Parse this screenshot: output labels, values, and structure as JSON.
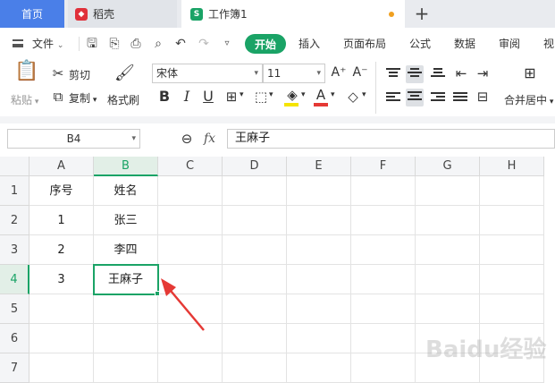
{
  "tabs": {
    "home": "首页",
    "daoke": "稻壳",
    "workbook": "工作簿1",
    "add": "+"
  },
  "menu": {
    "file": "文件",
    "start": "开始",
    "insert": "插入",
    "page_layout": "页面布局",
    "formula": "公式",
    "data": "数据",
    "review": "审阅",
    "view_partial": "视"
  },
  "ribbon": {
    "paste": "粘贴",
    "cut": "剪切",
    "copy": "复制",
    "format_painter": "格式刷",
    "font_name": "宋体",
    "font_size": "11",
    "bold": "B",
    "italic": "I",
    "underline": "U",
    "merge_center": "合并居中"
  },
  "formula_bar": {
    "name_box": "B4",
    "fx": "fx",
    "value": "王麻子"
  },
  "grid": {
    "columns": [
      "A",
      "B",
      "C",
      "D",
      "E",
      "F",
      "G",
      "H"
    ],
    "rows": [
      "1",
      "2",
      "3",
      "4",
      "5",
      "6",
      "7"
    ],
    "cells": {
      "A1": "序号",
      "B1": "姓名",
      "A2": "1",
      "B2": "张三",
      "A3": "2",
      "B3": "李四",
      "A4": "3",
      "B4": "王麻子"
    }
  },
  "colors": {
    "accent": "#1aa366",
    "home_tab": "#4a7fe8",
    "arrow": "#e53935"
  },
  "watermark": "Baidu经验"
}
